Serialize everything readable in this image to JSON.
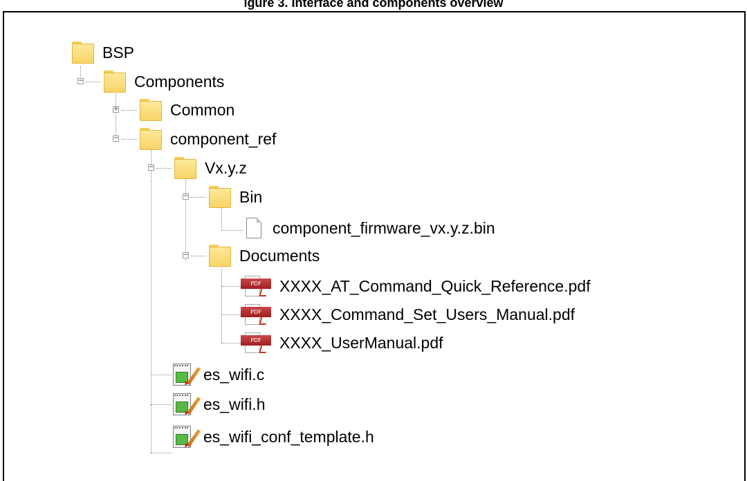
{
  "caption": "igure 3. Interface and components overview",
  "tree": {
    "bsp": "BSP",
    "components": "Components",
    "common": "Common",
    "component_ref": "component_ref",
    "version": "Vx.y.z",
    "bin": "Bin",
    "firmware": "component_firmware_vx.y.z.bin",
    "documents": "Documents",
    "doc1": "XXXX_AT_Command_Quick_Reference.pdf",
    "doc2": "XXXX_Command_Set_Users_Manual.pdf",
    "doc3": "XXXX_UserManual.pdf",
    "file_c": "es_wifi.c",
    "file_h": "es_wifi.h",
    "file_conf": "es_wifi_conf_template.h"
  },
  "icons": {
    "folder": "folder-icon",
    "file": "file-icon",
    "pdf": "pdf-icon",
    "source": "source-file-icon",
    "expand": "plus-icon",
    "collapse": "minus-icon"
  },
  "pdf_badge": "PDF"
}
